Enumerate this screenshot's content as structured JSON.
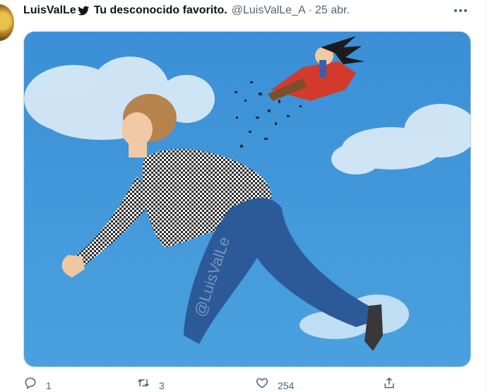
{
  "tweet": {
    "author_name": "LuisValLe",
    "display_name_rest": "Tu desconocido favorito.",
    "handle": "@LuisValLe_A",
    "separator": "·",
    "date": "25 abr.",
    "media": {
      "description_icon": "photo",
      "watermark": "@LuisValLe"
    },
    "actions": {
      "reply_count": "1",
      "retweet_count": "3",
      "like_count": "254"
    }
  },
  "colors": {
    "text_primary": "#0f1419",
    "text_secondary": "#536471",
    "border": "#cfd9de",
    "sky": "#3f95d8"
  },
  "icons": [
    "twitter-bird-icon",
    "more-icon",
    "reply-icon",
    "retweet-icon",
    "like-icon",
    "share-icon"
  ]
}
